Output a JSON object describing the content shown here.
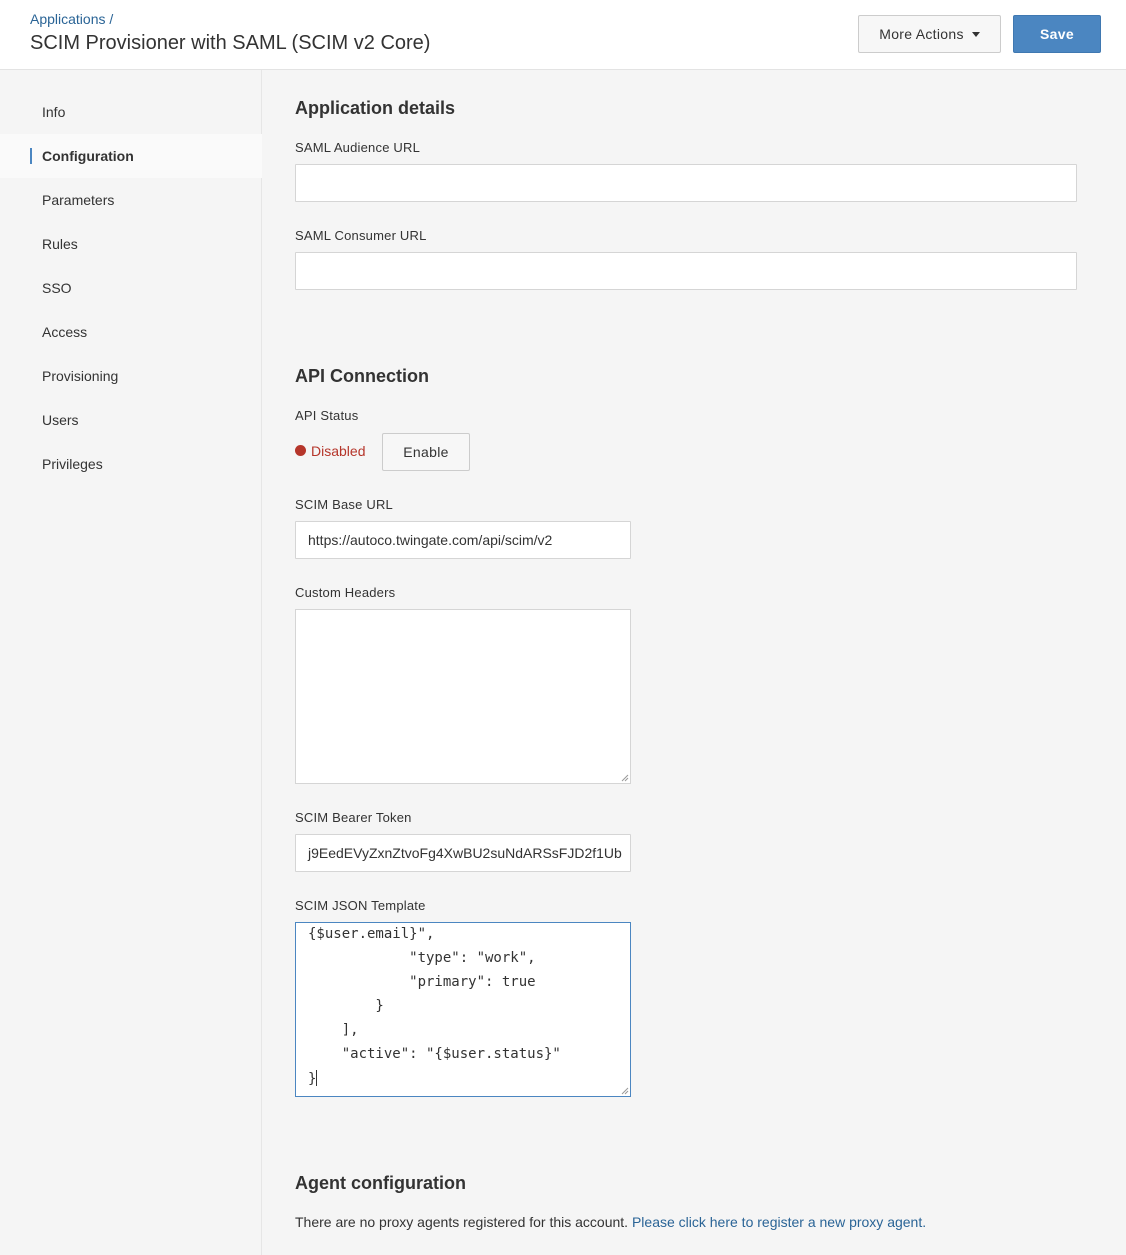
{
  "header": {
    "breadcrumb": "Applications /",
    "title": "SCIM Provisioner with SAML (SCIM v2 Core)",
    "more_actions_label": "More Actions",
    "save_label": "Save"
  },
  "sidebar": {
    "items": [
      {
        "label": "Info",
        "active": false
      },
      {
        "label": "Configuration",
        "active": true
      },
      {
        "label": "Parameters",
        "active": false
      },
      {
        "label": "Rules",
        "active": false
      },
      {
        "label": "SSO",
        "active": false
      },
      {
        "label": "Access",
        "active": false
      },
      {
        "label": "Provisioning",
        "active": false
      },
      {
        "label": "Users",
        "active": false
      },
      {
        "label": "Privileges",
        "active": false
      }
    ]
  },
  "application_details": {
    "title": "Application details",
    "saml_audience_label": "SAML Audience URL",
    "saml_audience_value": "",
    "saml_consumer_label": "SAML Consumer URL",
    "saml_consumer_value": ""
  },
  "api_connection": {
    "title": "API Connection",
    "status_label": "API Status",
    "status_value": "Disabled",
    "enable_label": "Enable",
    "scim_base_url_label": "SCIM Base URL",
    "scim_base_url_value": "https://autoco.twingate.com/api/scim/v2",
    "custom_headers_label": "Custom Headers",
    "custom_headers_value": "",
    "bearer_token_label": "SCIM Bearer Token",
    "bearer_token_value": "j9EedEVyZxnZtvoFg4XwBU2suNdARSsFJD2f1Ub",
    "json_template_label": "SCIM JSON Template",
    "json_template_lines": [
      "{$user.email}\",",
      "            \"type\": \"work\",",
      "            \"primary\": true",
      "        }",
      "    ],",
      "    \"active\": \"{$user.status}\"",
      "}"
    ]
  },
  "agent_configuration": {
    "title": "Agent configuration",
    "text": "There are no proxy agents registered for this account.",
    "link_text": "Please click here to register a new proxy agent."
  },
  "colors": {
    "primary": "#4b86c1",
    "link": "#2a6496",
    "status_disabled": "#b5352a"
  }
}
